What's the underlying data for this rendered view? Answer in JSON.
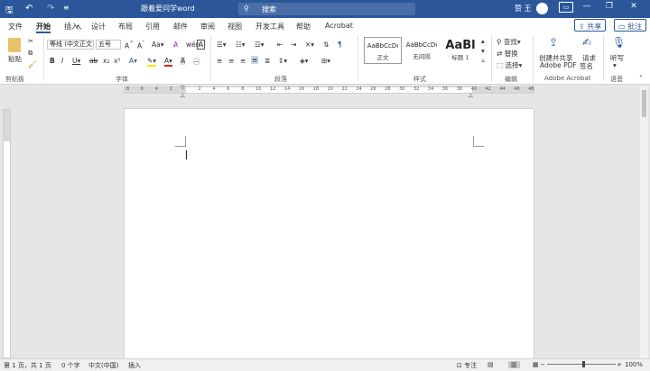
{
  "window": {
    "doc_title": "跟着爱问学word",
    "search_placeholder": "搜索",
    "user": "赞 王"
  },
  "tabs": [
    "文件",
    "开始",
    "插入",
    "设计",
    "布局",
    "引用",
    "邮件",
    "审阅",
    "视图",
    "开发工具",
    "帮助",
    "Acrobat"
  ],
  "share": {
    "share_label": "共享",
    "comment_label": "批注"
  },
  "ribbon": {
    "paste": "粘贴",
    "font_name": "等线 (中文正文",
    "font_size": "五号",
    "styles": [
      {
        "preview": "AaBbCcDı",
        "name": "正文"
      },
      {
        "preview": "AaBbCcDı",
        "name": "无间隔"
      },
      {
        "preview": "AaBl",
        "name": "标题 1"
      }
    ],
    "editing": {
      "find": "查找",
      "replace": "替换",
      "select": "选择"
    },
    "acrobat": {
      "create_pdf_1": "创建并共享",
      "create_pdf_2": "Adobe PDF",
      "request_sign_1": "请求",
      "request_sign_2": "签名"
    },
    "dictate": "听写",
    "groups": {
      "clipboard": "剪贴板",
      "font": "字体",
      "paragraph": "段落",
      "styles": "样式",
      "editing": "编辑",
      "acrobat": "Adobe Acrobat",
      "voice": "语音"
    }
  },
  "ruler_ticks": [
    "8",
    "6",
    "4",
    "2",
    "",
    "2",
    "4",
    "6",
    "8",
    "10",
    "12",
    "14",
    "16",
    "18",
    "20",
    "22",
    "24",
    "26",
    "28",
    "30",
    "32",
    "34",
    "36",
    "38",
    "40",
    "42",
    "44",
    "46",
    "48"
  ],
  "status": {
    "page": "第 1 页，共 1 页",
    "words": "0 个字",
    "language": "中文(中国)",
    "mode": "插入",
    "focus": "专注",
    "zoom": "100%"
  },
  "colors": {
    "titlebar": "#2b579a"
  }
}
